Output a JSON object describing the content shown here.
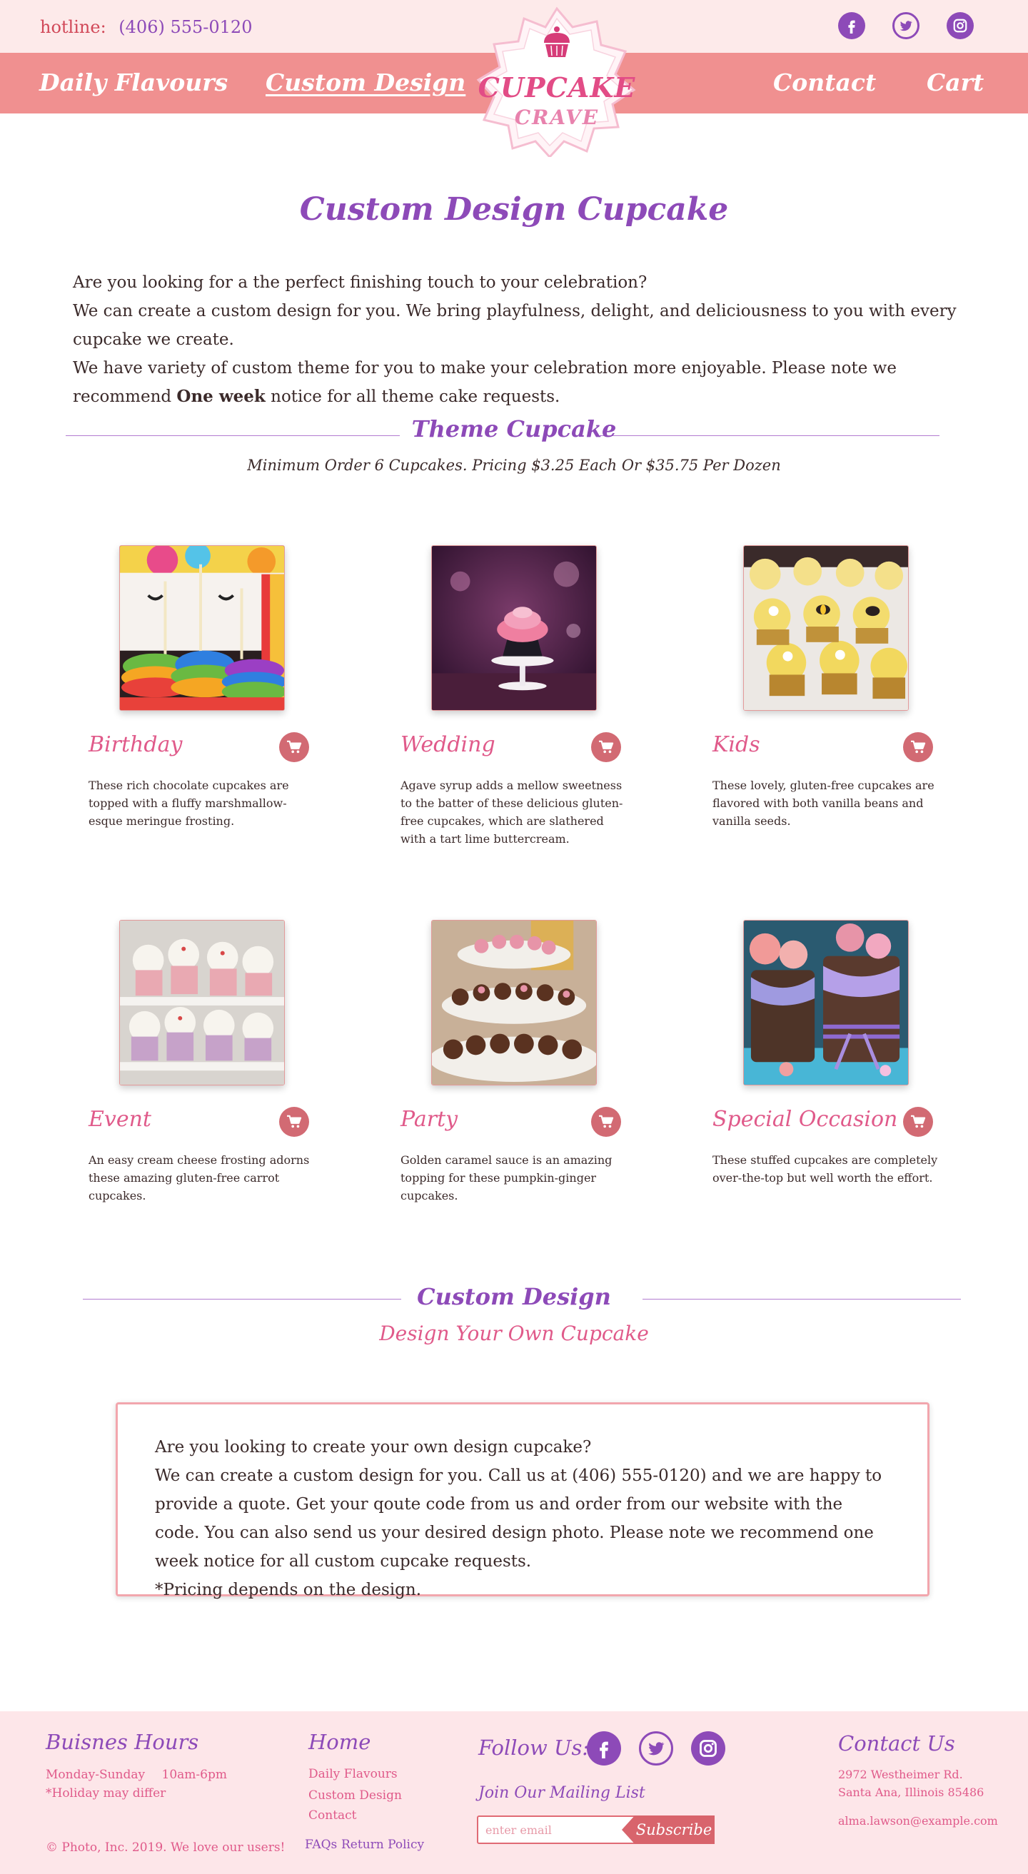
{
  "topbar": {
    "hotline_label": "hotline:",
    "hotline_number": "(406) 555-0120",
    "social": [
      "facebook-icon",
      "twitter-icon",
      "instagram-icon"
    ]
  },
  "nav": {
    "daily_flavours": "Daily Flavours",
    "custom_design": "Custom Design",
    "contact": "Contact",
    "cart": "Cart"
  },
  "logo": {
    "line1": "CUPCAKE",
    "line2": "CRAVE"
  },
  "page": {
    "title": "Custom Design Cupcake",
    "intro_line1": "Are you looking for a the perfect finishing touch to your celebration?",
    "intro_line2": "We can create a custom design for you. We bring playfulness, delight, and deliciousness to you with every cupcake we create.",
    "intro_line3a": "We have variety of custom theme for you to make your celebration more enjoyable. Please note we recommend ",
    "intro_bold": "One week",
    "intro_line3b": " notice for all theme cake requests."
  },
  "theme": {
    "heading": "Theme Cupcake",
    "pricing": "Minimum Order 6 Cupcakes. Pricing $3.25 Each Or $35.75 Per Dozen",
    "cards": [
      {
        "title": "Birthday",
        "desc": "These rich chocolate cupcakes are topped with a fluffy marshmallow-esque meringue frosting."
      },
      {
        "title": "Wedding",
        "desc": "Agave syrup adds a mellow sweetness to the batter of these delicious gluten-free cupcakes, which are slathered with a tart lime buttercream."
      },
      {
        "title": "Kids",
        "desc": "These lovely, gluten-free cupcakes are flavored with both vanilla beans and vanilla seeds."
      },
      {
        "title": "Event",
        "desc": "An easy cream cheese frosting adorns these amazing gluten-free carrot cupcakes."
      },
      {
        "title": "Party",
        "desc": "Golden caramel sauce is an amazing topping for these pumpkin-ginger cupcakes."
      },
      {
        "title": "Special Occasion",
        "desc": "These stuffed cupcakes are completely over-the-top but well worth the effort."
      }
    ]
  },
  "custom": {
    "heading": "Custom Design",
    "subheading": "Design Your Own Cupcake",
    "line1": "Are you looking to create your own design cupcake?",
    "line2": "We can create a custom design for you. Call us at (406) 555-0120)  and we are happy to provide a quote. Get your qoute code from us and order from our website with the code. You can also send us your desired design photo. Please note we recommend one week notice for all custom cupcake requests.",
    "line3": "*Pricing depends on the design."
  },
  "footer": {
    "hours_title": "Buisnes Hours",
    "hours_days": "Monday-Sunday",
    "hours_time": "10am-6pm",
    "hours_note": "*Holiday may differ",
    "copyright": "© Photo, Inc. 2019. We love our users!",
    "home_title": "Home",
    "home_links": [
      "Daily Flavours",
      "Custom Design",
      "Contact"
    ],
    "faqs": "FAQs",
    "return_policy": "Return Policy",
    "follow_title": "Follow Us:",
    "mailing_title": "Join Our Mailing List",
    "email_placeholder": "enter email",
    "subscribe": "Subscribe",
    "contact_title": "Contact Us",
    "address": "2972 Westheimer Rd. Santa Ana, Illinois 85486",
    "email": "alma.lawson@example.com"
  },
  "colors": {
    "brand_purple": "#8d4ab8",
    "brand_pink": "#e05a8a",
    "nav_bg": "#f09090",
    "topbar_bg": "#fdeaea",
    "cart_button": "#d26a73"
  }
}
